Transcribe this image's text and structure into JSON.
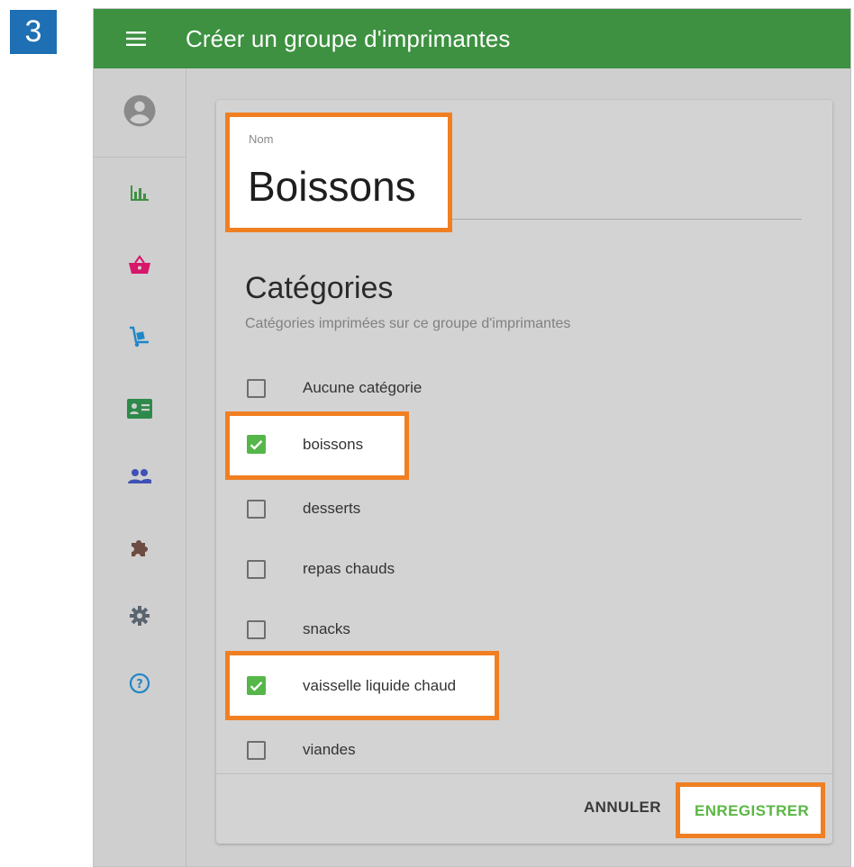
{
  "step_number": "3",
  "app_bar": {
    "title": "Créer un groupe d'imprimantes",
    "color": "#3d9140"
  },
  "sidebar": {
    "items": [
      {
        "icon": "account-circle-icon",
        "color": "#8a8a8a"
      },
      {
        "icon": "bar-chart-icon",
        "color": "#3d9140"
      },
      {
        "icon": "basket-icon",
        "color": "#d8166a"
      },
      {
        "icon": "hand-truck-icon",
        "color": "#1f87c8"
      },
      {
        "icon": "contact-card-icon",
        "color": "#2e8a4a"
      },
      {
        "icon": "people-icon",
        "color": "#3f51b5"
      },
      {
        "icon": "puzzle-icon",
        "color": "#6d4c41"
      },
      {
        "icon": "gear-icon",
        "color": "#5a6570"
      },
      {
        "icon": "help-icon",
        "color": "#1f87c8"
      }
    ]
  },
  "form": {
    "name_label": "Nom",
    "name_value": "Boissons",
    "categories_title": "Catégories",
    "categories_subtitle": "Catégories imprimées sur ce groupe d'imprimantes",
    "categories": [
      {
        "label": "Aucune catégorie",
        "checked": false
      },
      {
        "label": "boissons",
        "checked": true
      },
      {
        "label": "desserts",
        "checked": false
      },
      {
        "label": "repas chauds",
        "checked": false
      },
      {
        "label": "snacks",
        "checked": false
      },
      {
        "label": "vaisselle liquide chaud",
        "checked": true
      },
      {
        "label": "viandes",
        "checked": false
      }
    ]
  },
  "actions": {
    "cancel_label": "ANNULER",
    "save_label": "ENREGISTRER"
  },
  "colors": {
    "highlight": "#f07f22",
    "checkbox_checked": "#55b74a",
    "save_text": "#5bb744"
  }
}
